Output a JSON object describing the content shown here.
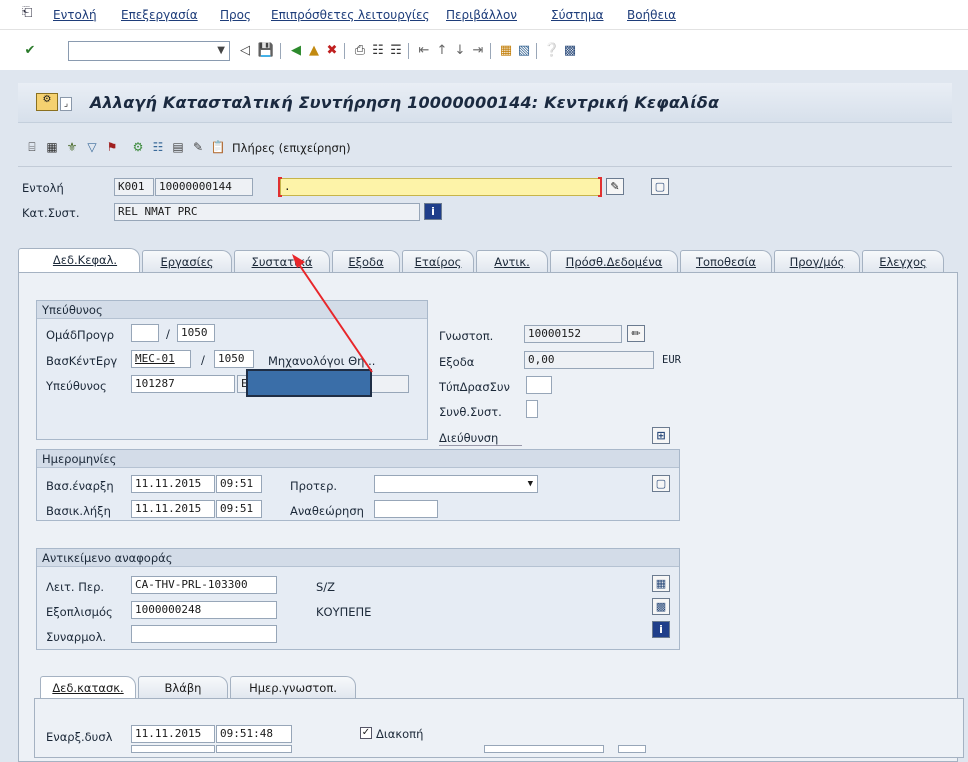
{
  "menu": {
    "items": [
      "Εντολή",
      "Επεξεργασία",
      "Προς",
      "Επιπρόσθετες λειτουργίες",
      "Περιβάλλον",
      "Σύστημα",
      "Βοήθεια"
    ]
  },
  "title": "Αλλαγή Κατασταλτική Συντήρηση 10000000144: Κεντρική Κεφαλίδα",
  "app_toolbar": {
    "full_label": "Πλήρες (επιχείρηση)"
  },
  "header": {
    "order_label": "Εντολή",
    "order_type": "K001",
    "order_number": "10000000144",
    "order_desc": ".",
    "status_label": "Κατ.Συστ.",
    "status_value": "REL  NMAT PRC"
  },
  "tabs": [
    "Δεδ.Κεφαλ.",
    "Εργασίες",
    "Συστατικά",
    "Εξοδα",
    "Εταίρος",
    "Αντικ.",
    "Πρόσθ.Δεδομένα",
    "Τοποθεσία",
    "Προγ/μός",
    "Ελεγχος"
  ],
  "responsible": {
    "header": "Υπεύθυνος",
    "plan_group_label": "ΟμάδΠρογρ",
    "plan_group_value": "",
    "plan_group_plant": "1050",
    "work_center_label": "ΒασΚέντΕργ",
    "work_center_value": "MEC-01",
    "work_center_plant": "1050",
    "work_center_desc": "Μηχανολόγοι Θη...",
    "person_label": "Υπεύθυνος",
    "person_value": "101287",
    "person_name": "E"
  },
  "notification": {
    "notif_label": "Γνωστοπ.",
    "notif_value": "10000152",
    "costs_label": "Εξοδα",
    "costs_value": "0,00",
    "currency": "EUR",
    "activity_type_label": "ΤύπΔρασΣυν",
    "sys_cond_label": "Συνθ.Συστ.",
    "address_label": "Διεύθυνση"
  },
  "dates": {
    "header": "Ημερομηνίες",
    "basic_start_label": "Βασ.έναρξη",
    "basic_start_date": "11.11.2015",
    "basic_start_time": "09:51",
    "basic_end_label": "Βασικ.λήξη",
    "basic_end_date": "11.11.2015",
    "basic_end_time": "09:51",
    "priority_label": "Προτερ.",
    "revision_label": "Αναθεώρηση"
  },
  "reference": {
    "header": "Αντικείμενο αναφοράς",
    "func_loc_label": "Λειτ. Περ.",
    "func_loc_value": "CA-THV-PRL-103300",
    "func_loc_desc": "S/Z",
    "equipment_label": "Εξοπλισμός",
    "equipment_value": "1000000248",
    "equipment_desc": "ΚΟΥΠΕΠΕ",
    "assembly_label": "Συναρμολ."
  },
  "subtabs": [
    "Δεδ.κατασκ.",
    "Βλάβη",
    "Ημερ.γνωστοπ."
  ],
  "malfunction": {
    "start_label": "Εναρξ.δυσλ",
    "start_date": "11.11.2015",
    "start_time": "09:51:48",
    "breakdown_label": "Διακοπή",
    "breakdown_checked": "✓"
  },
  "colors": {
    "accent_arrow": "#e8262a",
    "redact": "#3a6ea8",
    "yellow": "#fdf3a8"
  }
}
